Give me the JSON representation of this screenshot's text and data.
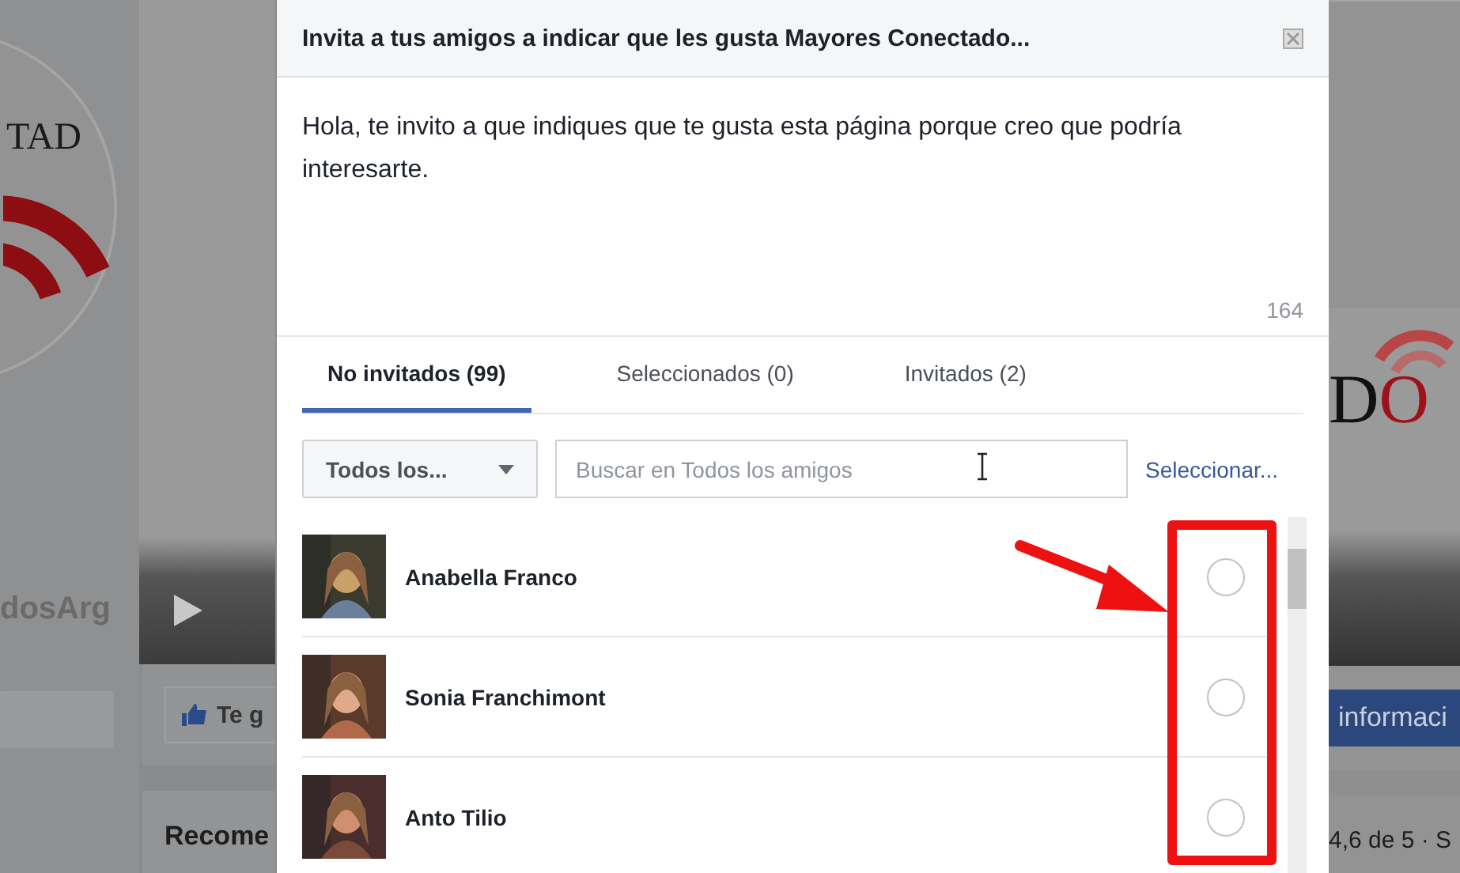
{
  "background": {
    "left_logo_text": "TAD",
    "left_page_name": "dosArg",
    "like_button": "Te g",
    "left_section_title": "Recome",
    "right_logo_text": "DO",
    "info_button": "informaci",
    "rating": "4,6 de 5 · S"
  },
  "dialog": {
    "title": "Invita a tus amigos a indicar que les gusta Mayores Conectado...",
    "message": "Hola, te invito a que indiques que te gusta esta página porque creo que podría interesarte.",
    "char_count": "164",
    "tabs": [
      {
        "label": "No invitados (99)",
        "selected": true
      },
      {
        "label": "Seleccionados (0)",
        "selected": false
      },
      {
        "label": "Invitados (2)",
        "selected": false
      }
    ],
    "filter": "Todos los...",
    "search": {
      "placeholder": "Buscar en Todos los amigos"
    },
    "select_link": "Seleccionar...",
    "friends": [
      {
        "name": "Anabella Franco",
        "selected": false
      },
      {
        "name": "Sonia Franchimont",
        "selected": false
      },
      {
        "name": "Anto Tilio",
        "selected": false
      }
    ]
  }
}
